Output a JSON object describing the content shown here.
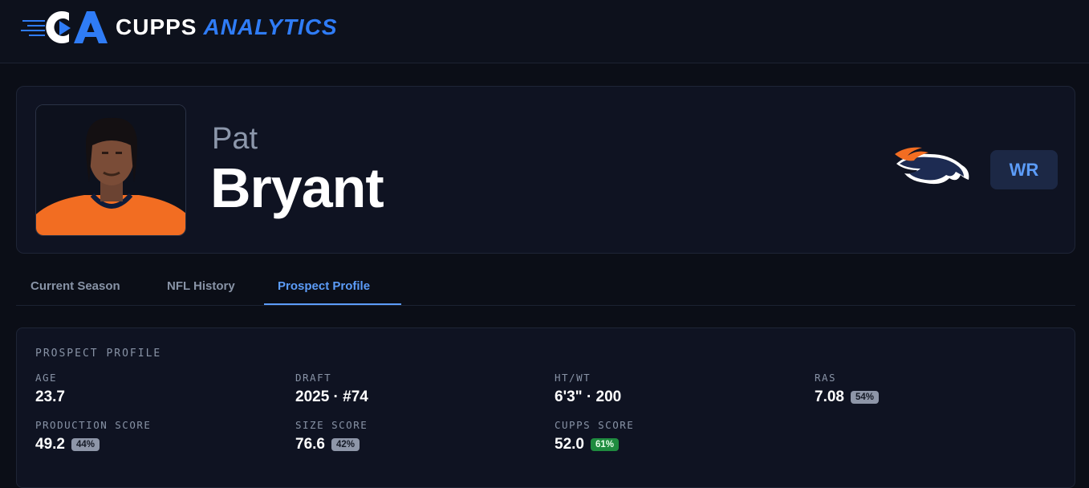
{
  "brand": {
    "name_a": "CUPPS",
    "name_b": "ANALYTICS",
    "logo_icon": "ca-play-logo"
  },
  "player": {
    "first_name": "Pat",
    "last_name": "Bryant",
    "position": "WR",
    "team_logo_icon": "broncos-horse-logo"
  },
  "tabs": [
    {
      "label": "Current Season",
      "active": false
    },
    {
      "label": "NFL History",
      "active": false
    },
    {
      "label": "Prospect Profile",
      "active": true
    }
  ],
  "profile": {
    "title": "PROSPECT PROFILE",
    "stats": [
      {
        "label": "AGE",
        "value": "23.7",
        "pct": null
      },
      {
        "label": "DRAFT",
        "value": "2025 · #74",
        "pct": null
      },
      {
        "label": "HT/WT",
        "value": "6'3\" · 200",
        "pct": null
      },
      {
        "label": "RAS",
        "value": "7.08",
        "pct": "54%"
      },
      {
        "label": "PRODUCTION SCORE",
        "value": "49.2",
        "pct": "44%"
      },
      {
        "label": "SIZE SCORE",
        "value": "76.6",
        "pct": "42%"
      },
      {
        "label": "CUPPS SCORE",
        "value": "52.0",
        "pct": "61%"
      }
    ]
  },
  "colors": {
    "accent": "#5c9cf8",
    "brand_blue": "#2f7cf6",
    "jersey_orange": "#f26d22",
    "good": "#1f8b3f"
  }
}
